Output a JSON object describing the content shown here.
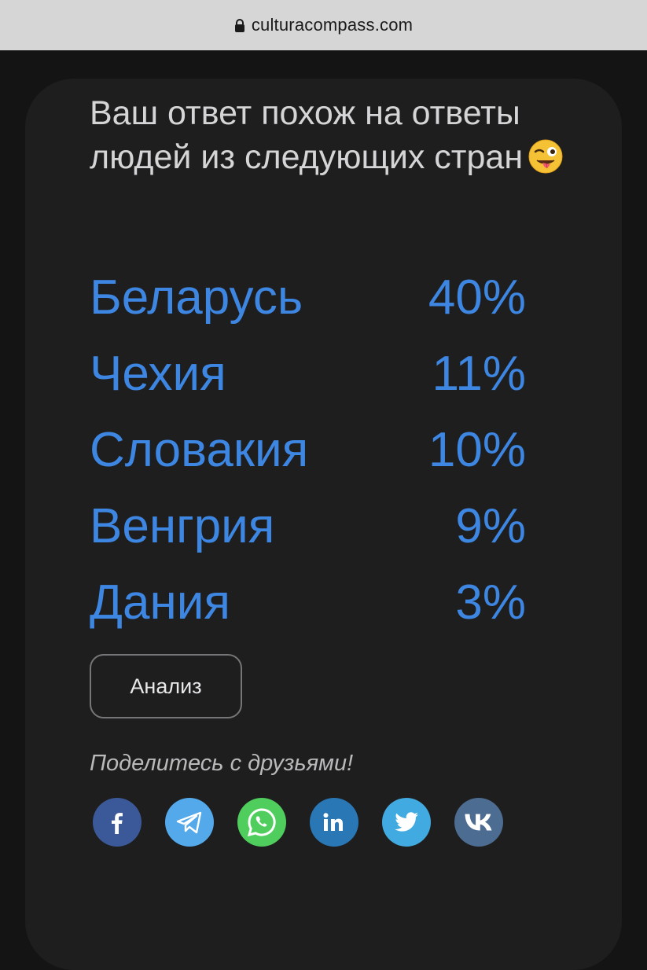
{
  "browser": {
    "url": "culturacompass.com"
  },
  "card": {
    "headline": "Ваш ответ похож на ответы людей из следующих стран",
    "headline_emoji": "winking-face-with-tongue"
  },
  "results": [
    {
      "country": "Беларусь",
      "percent": "40%"
    },
    {
      "country": "Чехия",
      "percent": "11%"
    },
    {
      "country": "Словакия",
      "percent": "10%"
    },
    {
      "country": "Венгрия",
      "percent": "9%"
    },
    {
      "country": "Дания",
      "percent": "3%"
    }
  ],
  "analysis_button": {
    "label": "Анализ"
  },
  "share": {
    "label": "Поделитесь с друзьями!",
    "buttons": [
      {
        "icon": "facebook-icon",
        "color": "#3b5998"
      },
      {
        "icon": "telegram-icon",
        "color": "#54a9eb"
      },
      {
        "icon": "whatsapp-icon",
        "color": "#4fce5d"
      },
      {
        "icon": "linkedin-icon",
        "color": "#2a77b5"
      },
      {
        "icon": "twitter-icon",
        "color": "#41abe1"
      },
      {
        "icon": "vk-icon",
        "color": "#4c6c91"
      }
    ]
  },
  "colors": {
    "accent": "#3d86e2",
    "card_background": "#1e1e1f",
    "page_background": "#141414",
    "url_bar": "#d6d6d6"
  }
}
